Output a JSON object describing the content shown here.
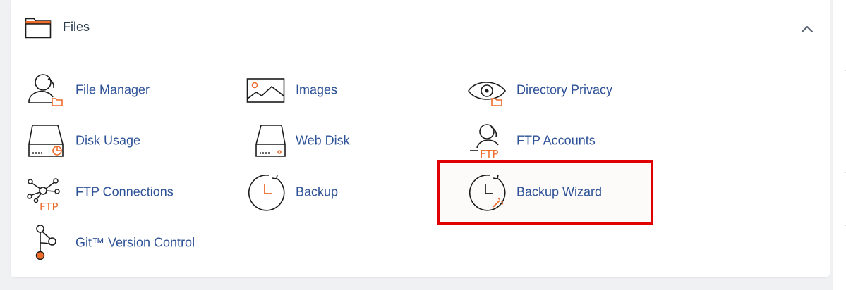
{
  "section": {
    "title": "Files",
    "icon": "folder-icon",
    "collapse_icon": "chevron-up-icon"
  },
  "items": [
    {
      "label": "File Manager",
      "icon": "user-folder-icon"
    },
    {
      "label": "Images",
      "icon": "image-icon"
    },
    {
      "label": "Directory Privacy",
      "icon": "eye-folder-icon"
    },
    {
      "label": "Disk Usage",
      "icon": "disk-usage-icon"
    },
    {
      "label": "Web Disk",
      "icon": "web-disk-icon"
    },
    {
      "label": "FTP Accounts",
      "icon": "ftp-user-icon"
    },
    {
      "label": "FTP Connections",
      "icon": "ftp-network-icon"
    },
    {
      "label": "Backup",
      "icon": "backup-clock-icon"
    },
    {
      "label": "Backup Wizard",
      "icon": "backup-wizard-icon",
      "highlighted": true
    },
    {
      "label": "Git™ Version Control",
      "icon": "git-branch-icon"
    }
  ],
  "icon_text": {
    "ftp": "FTP"
  },
  "colors": {
    "accent": "#ef6b2a",
    "link": "#2e5297",
    "icon_stroke": "#1b1b1b",
    "highlight_border": "#e00000"
  }
}
